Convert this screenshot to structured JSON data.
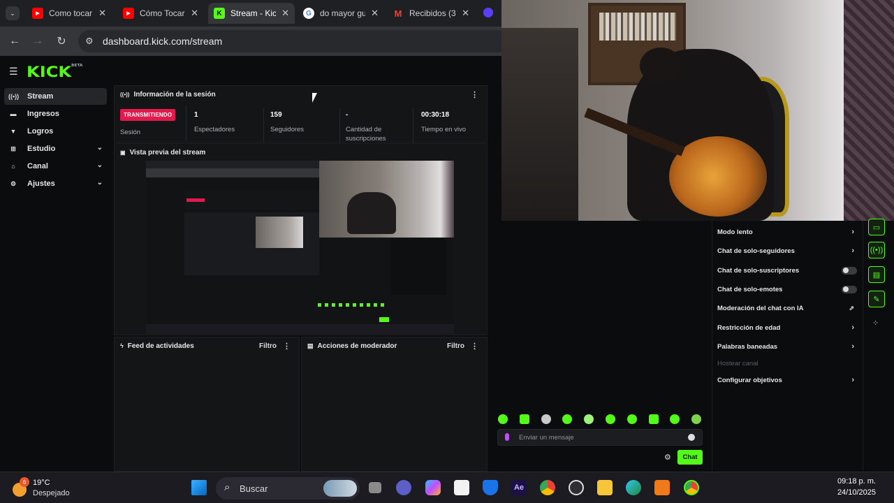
{
  "browser": {
    "tabs": [
      {
        "title": "Como tocar",
        "icon": "youtube-icon",
        "active": false
      },
      {
        "title": "Cómo Tocar",
        "icon": "youtube-icon",
        "active": false
      },
      {
        "title": "Stream - Kick",
        "icon": "kick-icon",
        "active": true
      },
      {
        "title": "do mayor gu",
        "icon": "google-icon",
        "active": false
      },
      {
        "title": "Recibidos (3",
        "icon": "gmail-icon",
        "active": false
      }
    ],
    "url": "dashboard.kick.com/stream"
  },
  "app": {
    "logo": "KICK",
    "logo_badge": "BETA",
    "sidebar": [
      {
        "label": "Stream",
        "icon": "broadcast-icon",
        "active": true,
        "expandable": false
      },
      {
        "label": "Ingresos",
        "icon": "wallet-icon",
        "active": false,
        "expandable": false
      },
      {
        "label": "Logros",
        "icon": "trophy-icon",
        "active": false,
        "expandable": false
      },
      {
        "label": "Estudio",
        "icon": "studio-icon",
        "active": false,
        "expandable": true
      },
      {
        "label": "Canal",
        "icon": "channel-icon",
        "active": false,
        "expandable": true
      },
      {
        "label": "Ajustes",
        "icon": "gear-icon",
        "active": false,
        "expandable": true
      }
    ],
    "session": {
      "title": "Información de la sesión",
      "status_badge": "TRANSMITIENDO",
      "status_label": "Sesión",
      "stats": [
        {
          "value": "1",
          "label": "Espectadores"
        },
        {
          "value": "159",
          "label": "Seguidores"
        },
        {
          "value": "-",
          "label": "Cantidad de suscripciones"
        },
        {
          "value": "00:30:18",
          "label": "Tiempo en vivo"
        }
      ]
    },
    "preview": {
      "title": "Vista previa del stream"
    },
    "activity": {
      "title": "Feed de actividades",
      "filter": "Filtro"
    },
    "moderator": {
      "title": "Acciones de moderador",
      "filter": "Filtro"
    },
    "chat_settings": [
      {
        "label": "Modo lento",
        "control": "chevron"
      },
      {
        "label": "Chat de solo-seguidores",
        "control": "chevron"
      },
      {
        "label": "Chat de solo-suscriptores",
        "control": "toggle"
      },
      {
        "label": "Chat de solo-emotes",
        "control": "toggle"
      },
      {
        "label": "Moderación del chat con IA",
        "control": "chart"
      },
      {
        "label": "Restricción de edad",
        "control": "chevron"
      },
      {
        "label": "Palabras baneadas",
        "control": "chevron"
      },
      {
        "label": "Hostear canal",
        "control": "disabled"
      },
      {
        "label": "Configurar objetivos",
        "control": "chevron"
      }
    ],
    "chat": {
      "placeholder": "Enviar un mensaje",
      "send": "Chat"
    }
  },
  "taskbar": {
    "weather_badge": "6",
    "temperature": "19°C",
    "condition": "Despejado",
    "search": "Buscar",
    "time": "09:18 p. m.",
    "date": "24/10/2025"
  },
  "colors": {
    "kick_green": "#53fc18",
    "live_red": "#e3194d"
  }
}
